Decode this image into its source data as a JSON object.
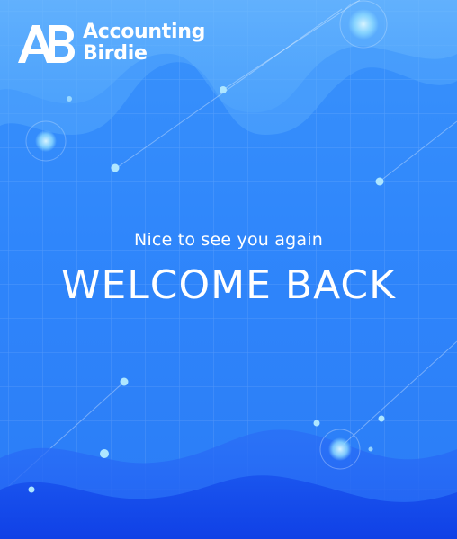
{
  "brand": {
    "monogram": "AB",
    "name_line1": "Accounting",
    "name_line2": "Birdie"
  },
  "hero": {
    "greeting": "Nice to see you again",
    "heading": "WELCOME BACK"
  },
  "colors": {
    "background": "#2f86fb",
    "wave_light": "#5aaefc",
    "wave_dark": "#1652f0",
    "text": "#ffffff"
  }
}
